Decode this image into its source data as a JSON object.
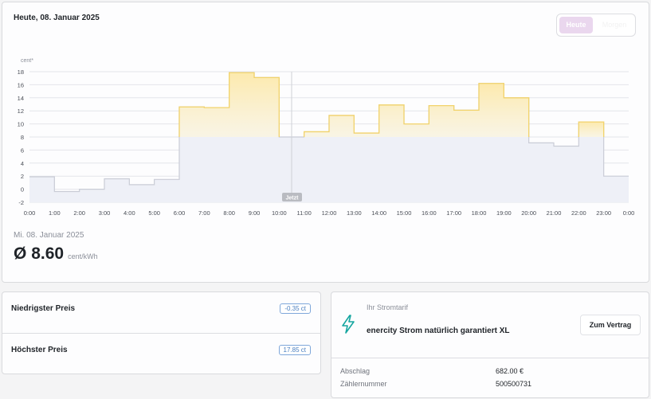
{
  "header": {
    "title": "Heute, 08. Januar 2025",
    "toggle": {
      "active_label": "Heute",
      "inactive_label": "Morgen"
    }
  },
  "chart_data": {
    "type": "step-area",
    "y_unit_label": "cent*",
    "yticks": [
      "18",
      "16",
      "14",
      "12",
      "10",
      "8",
      "6",
      "4",
      "2",
      "0",
      "-2"
    ],
    "ylim": [
      -2,
      18
    ],
    "x_labels": [
      "0:00",
      "1:00",
      "2:00",
      "3:00",
      "4:00",
      "5:00",
      "6:00",
      "7:00",
      "8:00",
      "9:00",
      "10:00",
      "11:00",
      "12:00",
      "13:00",
      "14:00",
      "15:00",
      "16:00",
      "17:00",
      "18:00",
      "19:00",
      "20:00",
      "21:00",
      "22:00",
      "23:00",
      "0:00"
    ],
    "hourly_values": [
      1.9,
      -0.35,
      0.0,
      1.6,
      0.7,
      1.5,
      12.6,
      12.5,
      17.85,
      17.1,
      8.0,
      8.8,
      11.3,
      8.6,
      12.9,
      10.0,
      12.8,
      12.1,
      16.2,
      14.0,
      7.1,
      6.6,
      10.3,
      2.0
    ],
    "now_hour": 10.5,
    "now_label": "Jetzt",
    "highlight_threshold": 8,
    "colors": {
      "base_fill": "#eef0f7",
      "base_line": "#c9ccd6",
      "high_fill": "#fdf0c2",
      "high_line": "#f2d36b",
      "grid": "#e4e5ea",
      "now_line": "#cfd1d6",
      "now_badge": "#b9bbc1"
    }
  },
  "summary": {
    "date": "Mi. 08. Januar 2025",
    "avg_symbol": "Ø",
    "avg_value": "8.60",
    "avg_unit": "cent/kWh"
  },
  "prices": {
    "lowest_label": "Niedrigster Preis",
    "lowest_value": "-0.35 ct",
    "highest_label": "Höchster Preis",
    "highest_value": "17.85 ct"
  },
  "tariff": {
    "caption": "Ihr Stromtarif",
    "name": "enercity Strom natürlich garantiert XL",
    "button_label": "Zum Vertrag",
    "abschlag_label": "Abschlag",
    "abschlag_value": "682.00 €",
    "zaehler_label": "Zählernummer",
    "zaehler_value": "500500731",
    "icon": "lightning-bolt-icon",
    "accent": "#16a6a0"
  }
}
